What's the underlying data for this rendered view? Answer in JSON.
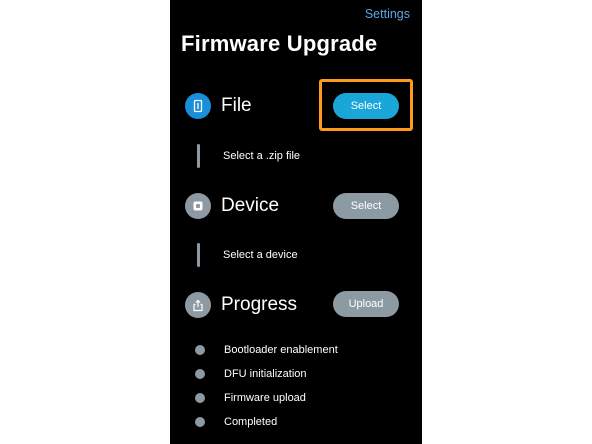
{
  "header": {
    "settings_label": "Settings",
    "title": "Firmware Upgrade"
  },
  "sections": {
    "file": {
      "label": "File",
      "button_label": "Select",
      "subtext": "Select a .zip file",
      "icon": "file-icon"
    },
    "device": {
      "label": "Device",
      "button_label": "Select",
      "subtext": "Select a device",
      "icon": "device-icon"
    },
    "progress": {
      "label": "Progress",
      "button_label": "Upload",
      "icon": "share-upload-icon",
      "steps": [
        "Bootloader enablement",
        "DFU initialization",
        "Firmware upload",
        "Completed"
      ]
    }
  },
  "colors": {
    "background": "#000000",
    "accent_blue": "#1aa6d8",
    "inactive_grey": "#8c9aa4",
    "highlight_orange": "#ff9a1f",
    "link_blue": "#5aa6e8"
  }
}
